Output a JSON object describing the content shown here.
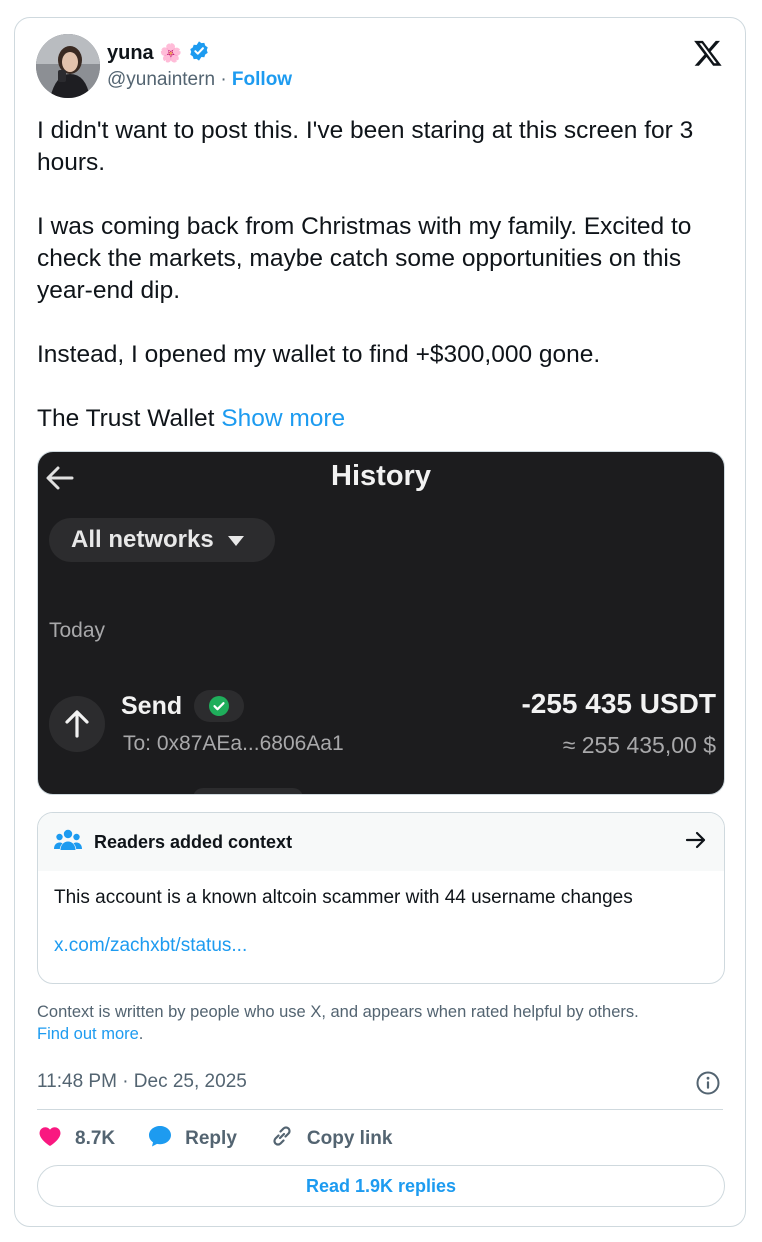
{
  "author": {
    "name": "yuna",
    "emoji": "🌸",
    "handle": "@yunaintern",
    "separator": "·",
    "follow_label": "Follow"
  },
  "tweet": {
    "paragraphs": [
      "I didn't want to post this. I've been staring at this screen for 3 hours.",
      "I was coming back from Christmas with my family. Excited to check the markets, maybe catch some opportunities on this year-end dip.",
      "Instead, I opened my wallet to find +$300,000 gone."
    ],
    "last_line": "The Trust Wallet",
    "show_more_label": "Show more"
  },
  "screenshot": {
    "title": "History",
    "network_filter": "All networks",
    "section_label": "Today",
    "tx_type": "Send",
    "tx_to": "To: 0x87AEa...6806Aa1",
    "tx_amount": "-255 435 USDT",
    "tx_usd": "≈ 255 435,00 $"
  },
  "community_note": {
    "header": "Readers added context",
    "body": "This account is a known altcoin scammer with 44 username changes",
    "link": "x.com/zachxbt/status..."
  },
  "context_footer": {
    "text": "Context is written by people who use X, and appears when rated helpful by others.",
    "link": "Find out more",
    "period": "."
  },
  "timestamp": "11:48 PM · Dec 25, 2025",
  "actions": {
    "likes": "8.7K",
    "reply_label": "Reply",
    "copy_link_label": "Copy link"
  },
  "read_replies_label": "Read 1.9K replies",
  "colors": {
    "accent": "#1d9bf0",
    "like": "#f91880",
    "verified": "#1d9bf0",
    "screenshot_bg": "#1c1c1e",
    "success": "#00c853"
  }
}
